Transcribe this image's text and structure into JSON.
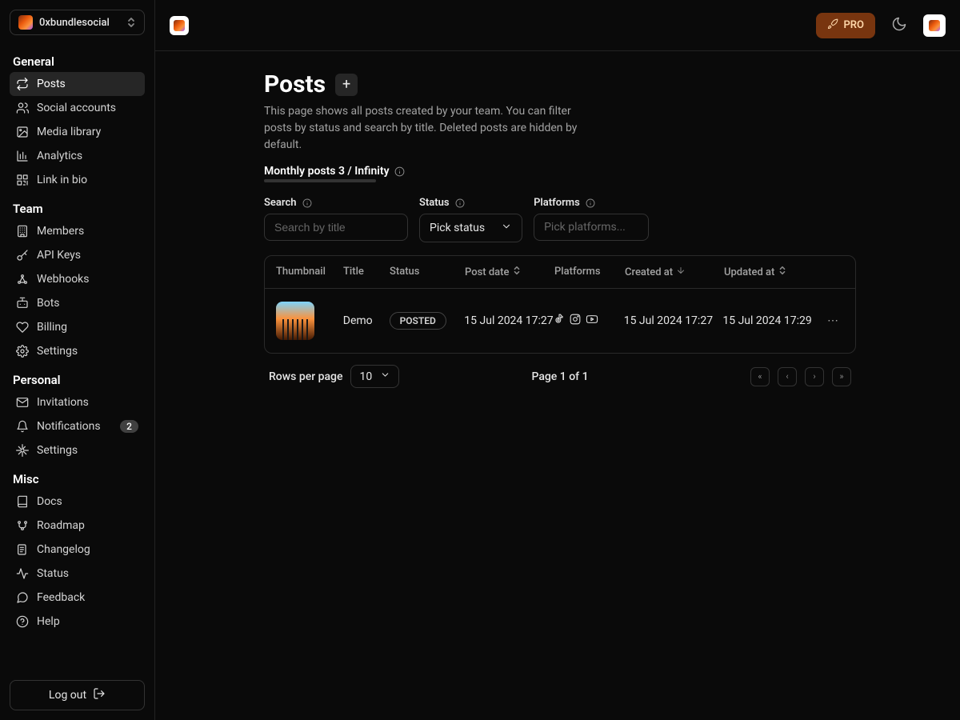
{
  "workspace": {
    "name": "0xbundlesocial"
  },
  "sidebar": {
    "sections": [
      {
        "title": "General",
        "items": [
          {
            "label": "Posts",
            "icon": "repeat"
          },
          {
            "label": "Social accounts",
            "icon": "users"
          },
          {
            "label": "Media library",
            "icon": "image"
          },
          {
            "label": "Analytics",
            "icon": "bar-chart"
          },
          {
            "label": "Link in bio",
            "icon": "qr"
          }
        ]
      },
      {
        "title": "Team",
        "items": [
          {
            "label": "Members",
            "icon": "building"
          },
          {
            "label": "API Keys",
            "icon": "key"
          },
          {
            "label": "Webhooks",
            "icon": "webhook"
          },
          {
            "label": "Bots",
            "icon": "bot"
          },
          {
            "label": "Billing",
            "icon": "heart"
          },
          {
            "label": "Settings",
            "icon": "gear"
          }
        ]
      },
      {
        "title": "Personal",
        "items": [
          {
            "label": "Invitations",
            "icon": "mail"
          },
          {
            "label": "Notifications",
            "icon": "bell",
            "badge": "2"
          },
          {
            "label": "Settings",
            "icon": "gear"
          }
        ]
      },
      {
        "title": "Misc",
        "items": [
          {
            "label": "Docs",
            "icon": "book"
          },
          {
            "label": "Roadmap",
            "icon": "road"
          },
          {
            "label": "Changelog",
            "icon": "scroll"
          },
          {
            "label": "Status",
            "icon": "activity"
          },
          {
            "label": "Feedback",
            "icon": "message"
          },
          {
            "label": "Help",
            "icon": "help"
          }
        ]
      }
    ],
    "logout": "Log out"
  },
  "topbar": {
    "pro": "PRO"
  },
  "page": {
    "title": "Posts",
    "description": "This page shows all posts created by your team. You can filter posts by status and search by title. Deleted posts are hidden by default.",
    "monthly": "Monthly posts 3 / Infinity"
  },
  "filters": {
    "search": {
      "label": "Search",
      "placeholder": "Search by title"
    },
    "status": {
      "label": "Status",
      "placeholder": "Pick status"
    },
    "platforms": {
      "label": "Platforms",
      "placeholder": "Pick platforms..."
    }
  },
  "table": {
    "columns": {
      "thumbnail": "Thumbnail",
      "title": "Title",
      "status": "Status",
      "postdate": "Post date",
      "platforms": "Platforms",
      "created": "Created at",
      "updated": "Updated at"
    },
    "rows": [
      {
        "title": "Demo",
        "status": "POSTED",
        "postdate": "15 Jul 2024 17:27",
        "platforms": [
          "tiktok",
          "instagram",
          "youtube"
        ],
        "created": "15 Jul 2024 17:27",
        "updated": "15 Jul 2024 17:29"
      }
    ]
  },
  "pagination": {
    "rpp_label": "Rows per page",
    "rpp_value": "10",
    "page_text": "Page 1 of 1"
  }
}
